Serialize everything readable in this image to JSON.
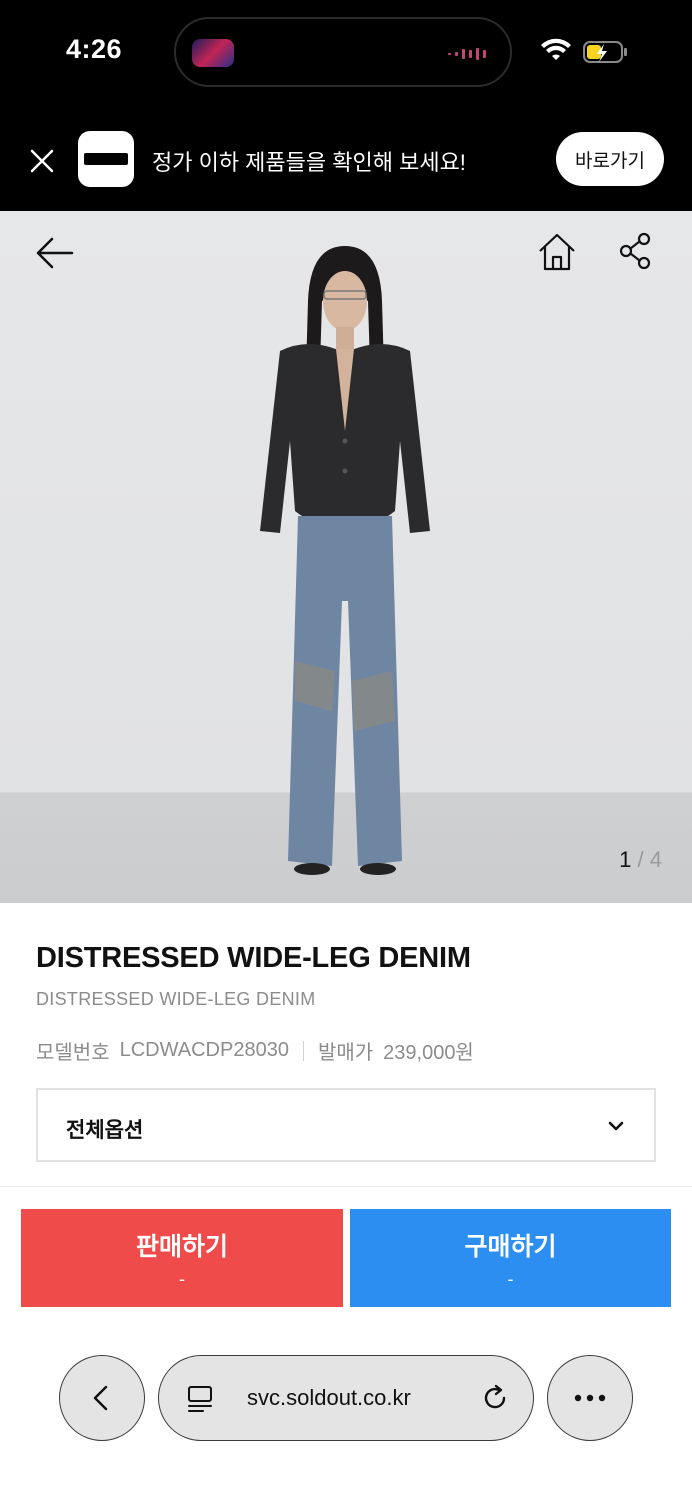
{
  "status_bar": {
    "time": "4:26"
  },
  "banner": {
    "text": "정가 이하 제품들을 확인해 보세요!",
    "button": "바로가기"
  },
  "gallery": {
    "current": "1",
    "separator": "/",
    "total": "4"
  },
  "product": {
    "title": "DISTRESSED WIDE-LEG DENIM",
    "subtitle": "DISTRESSED WIDE-LEG DENIM",
    "model_label": "모델번호",
    "model_value": "LCDWACDP28030",
    "release_label": "발매가",
    "release_value": "239,000원"
  },
  "options": {
    "label": "전체옵션"
  },
  "actions": {
    "sell_label": "판매하기",
    "sell_price": "-",
    "buy_label": "구매하기",
    "buy_price": "-"
  },
  "browser": {
    "url": "svc.soldout.co.kr"
  },
  "colors": {
    "sell": "#f04b4b",
    "buy": "#2b8ef0",
    "banner_bg": "#000000"
  },
  "icons": [
    "close-icon",
    "back-arrow-icon",
    "home-icon",
    "share-icon",
    "chevron-down-icon",
    "chevron-left-icon",
    "tabs-icon",
    "reload-icon",
    "more-icon"
  ]
}
